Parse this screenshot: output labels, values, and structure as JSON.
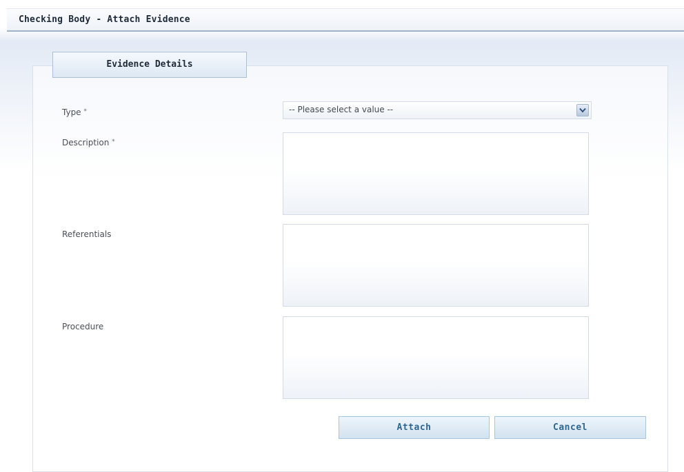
{
  "window": {
    "title": "Checking Body - Attach Evidence"
  },
  "section": {
    "tab_label": "Evidence Details"
  },
  "form": {
    "type": {
      "label": "Type",
      "required_mark": "*",
      "selected_value": "-- Please select a value --"
    },
    "description": {
      "label": "Description",
      "required_mark": "*",
      "value": ""
    },
    "referentials": {
      "label": "Referentials",
      "value": ""
    },
    "procedure": {
      "label": "Procedure",
      "value": ""
    }
  },
  "actions": {
    "attach_label": "Attach",
    "cancel_label": "Cancel"
  },
  "colors": {
    "accent": "#2f6690",
    "header_border": "#9fb2cc"
  }
}
